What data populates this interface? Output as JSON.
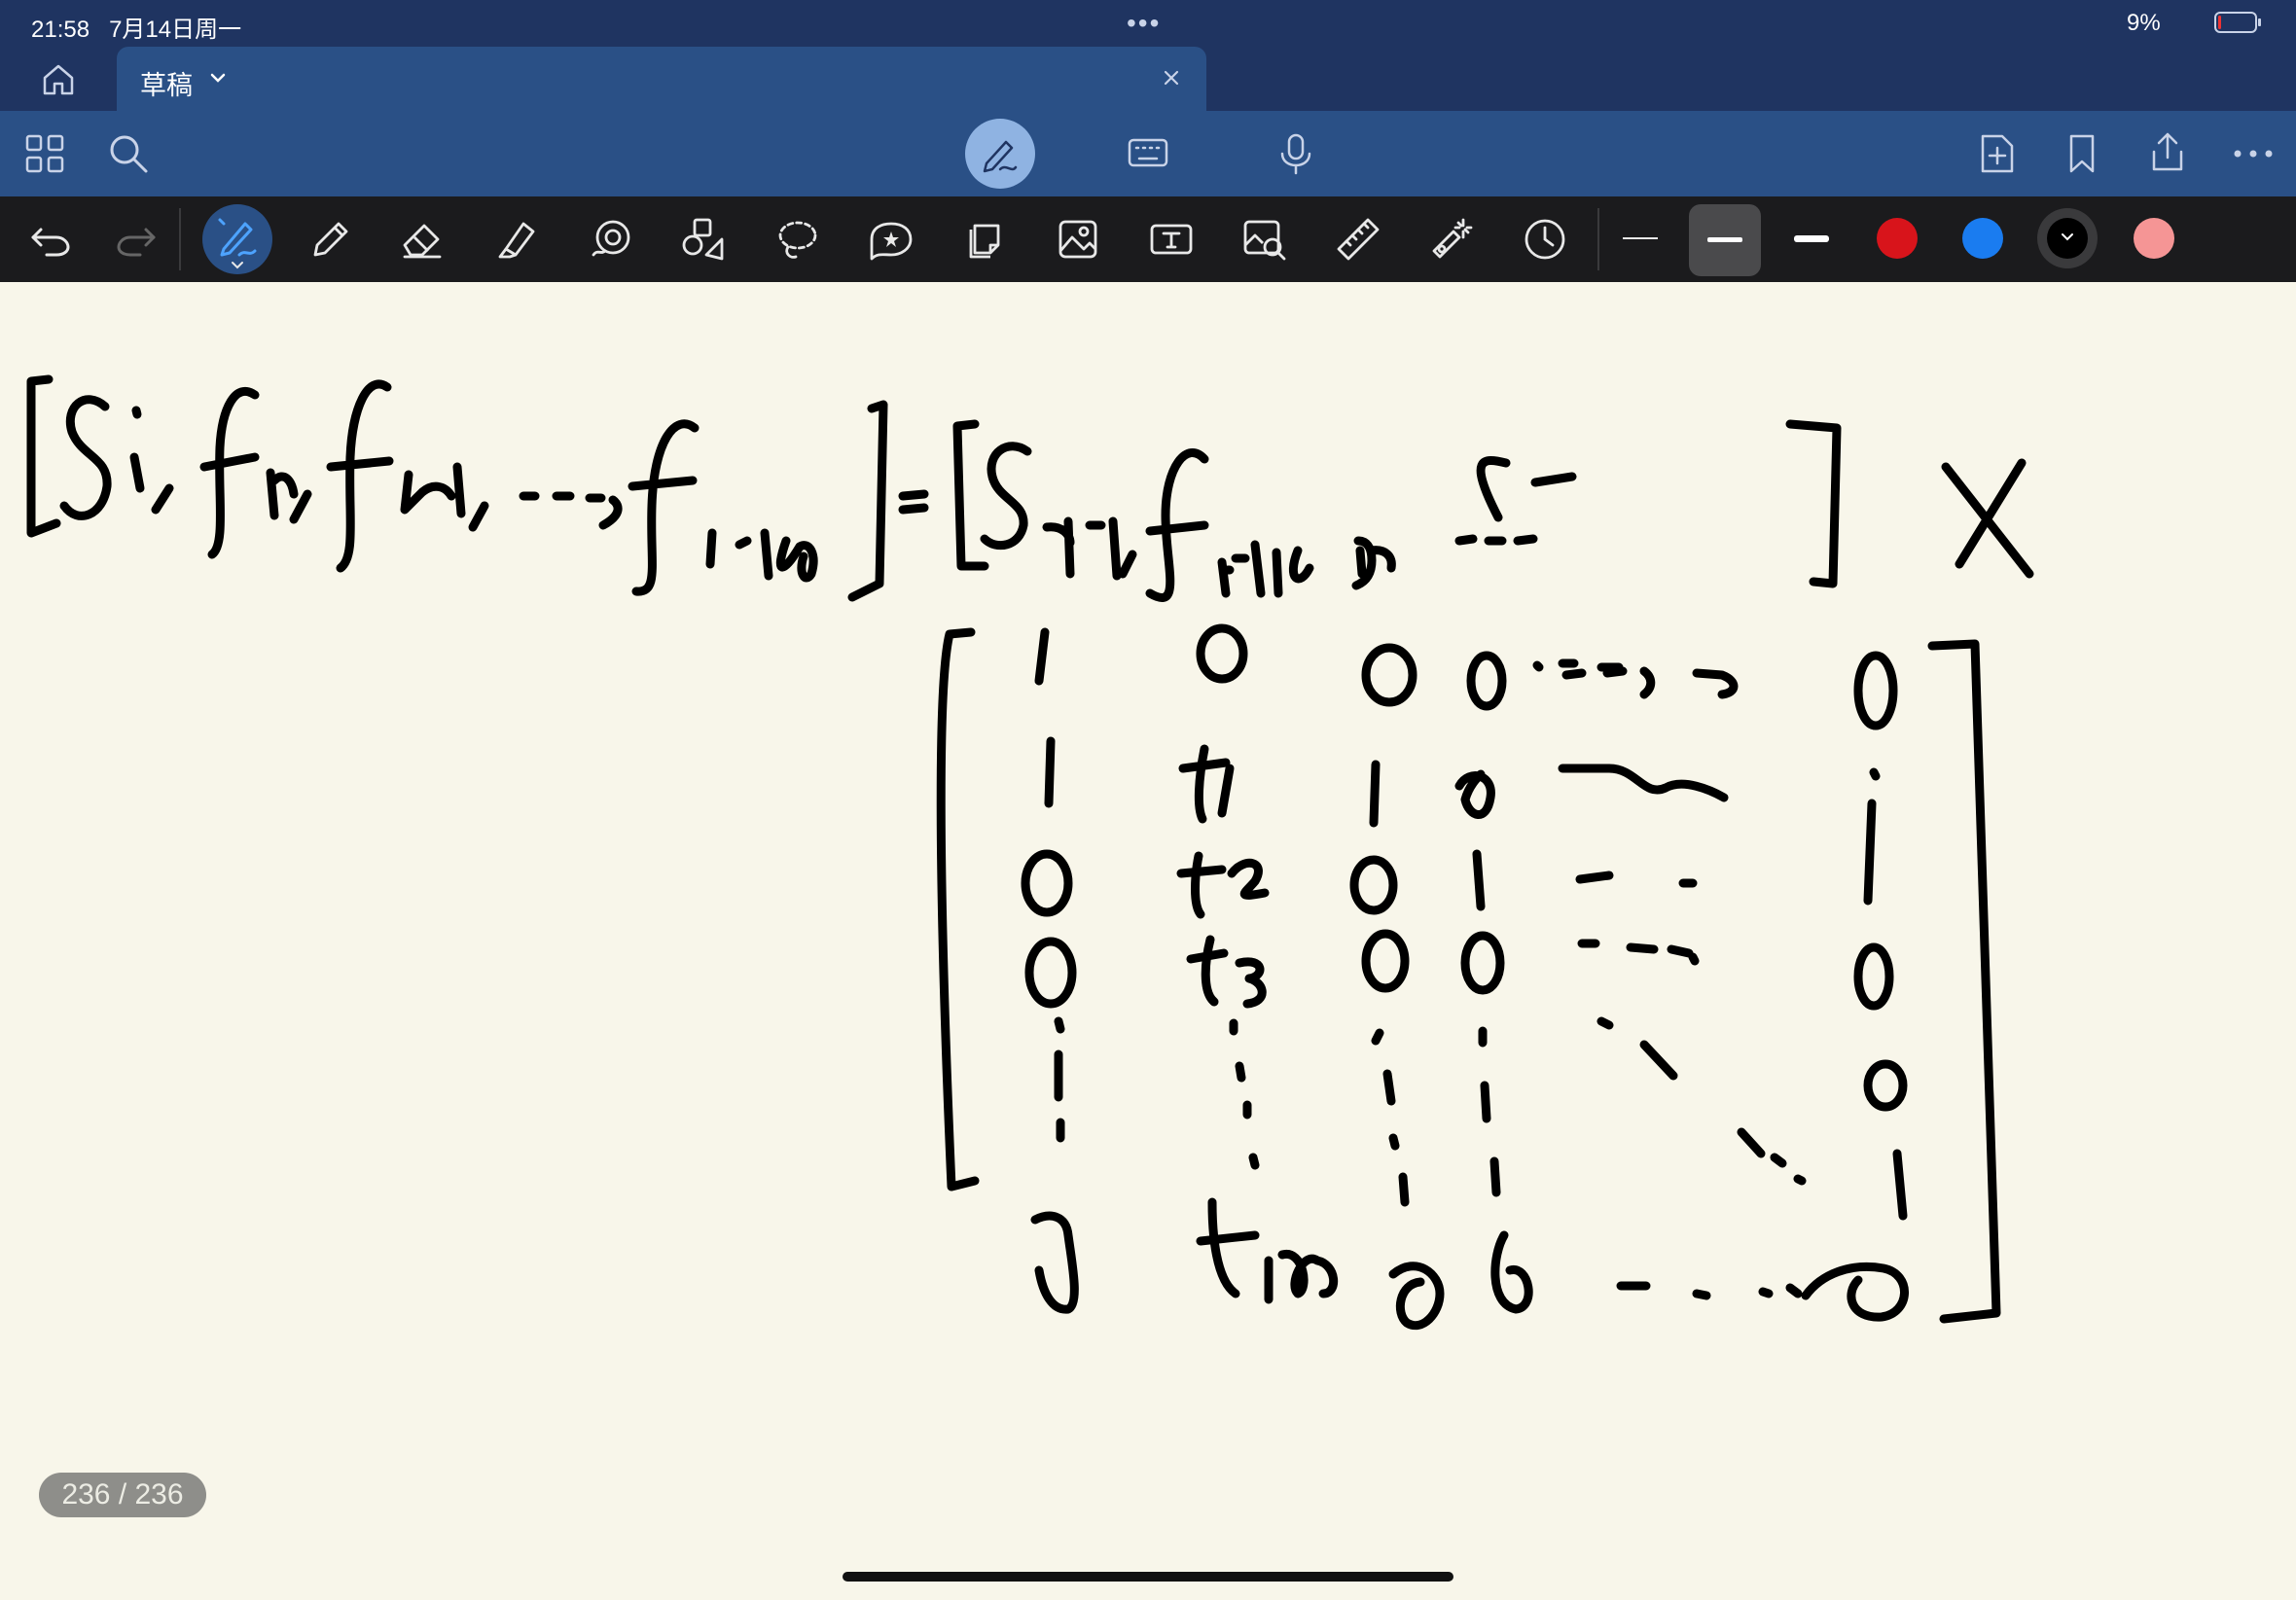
{
  "status_bar": {
    "time": "21:58",
    "date": "7月14日周一",
    "dots": "•••",
    "battery_percent": "9%",
    "battery_level": 0.09
  },
  "tab": {
    "title": "草稿"
  },
  "page_counter": "236 / 236",
  "colors": {
    "header_dark": "#1f3461",
    "header_blue": "#2a5086",
    "toolbar_dark": "#1b1b1d",
    "paper": "#f8f6ea",
    "swatch_red": "#d8141b",
    "swatch_blue": "#1a7cf0",
    "swatch_black": "#000000",
    "swatch_pink": "#f59595"
  },
  "icons": {
    "top_left": [
      "home-icon",
      "grid-icon",
      "search-icon"
    ],
    "top_center": [
      "pen-mode-icon",
      "keyboard-icon",
      "microphone-icon"
    ],
    "top_right": [
      "add-page-icon",
      "bookmark-icon",
      "share-icon",
      "more-icon"
    ],
    "tools": [
      "undo-icon",
      "redo-icon",
      "pen-tool-icon",
      "pencil-icon",
      "eraser-icon",
      "highlighter-icon",
      "shape-recognition-icon",
      "shapes-icon",
      "lasso-icon",
      "sticker-icon",
      "sticky-note-icon",
      "image-icon",
      "text-icon",
      "screenshot-icon",
      "ruler-icon",
      "laser-pointer-icon",
      "history-icon"
    ]
  }
}
